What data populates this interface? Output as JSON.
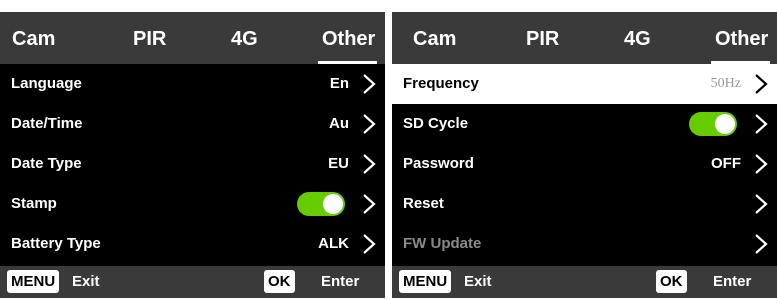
{
  "colors": {
    "header_bg": "#3a3a3a",
    "screen_bg": "#000000",
    "toggle_on": "#66cc00",
    "selected_row_bg": "#ffffff",
    "disabled_text": "#8a8a8a"
  },
  "left_screen": {
    "tabs": [
      {
        "label": "Cam"
      },
      {
        "label": "PIR"
      },
      {
        "label": "4G"
      },
      {
        "label": "Other",
        "active": true
      }
    ],
    "rows": [
      {
        "label": "Language",
        "value": "En"
      },
      {
        "label": "Date/Time",
        "value": "Au"
      },
      {
        "label": "Date Type",
        "value": "EU"
      },
      {
        "label": "Stamp",
        "toggle": "on"
      },
      {
        "label": "Battery Type",
        "value": "ALK"
      }
    ],
    "footer": {
      "menu_key": "MENU",
      "menu_action": "Exit",
      "ok_key": "OK",
      "ok_action": "Enter"
    }
  },
  "right_screen": {
    "tabs": [
      {
        "label": "Cam"
      },
      {
        "label": "PIR"
      },
      {
        "label": "4G"
      },
      {
        "label": "Other",
        "active": true
      }
    ],
    "rows": [
      {
        "label": "Frequency",
        "value": "50Hz",
        "selected": true
      },
      {
        "label": "SD Cycle",
        "toggle": "on"
      },
      {
        "label": "Password",
        "value": "OFF"
      },
      {
        "label": "Reset",
        "value": ""
      },
      {
        "label": "FW Update",
        "value": "",
        "disabled": true
      }
    ],
    "footer": {
      "menu_key": "MENU",
      "menu_action": "Exit",
      "ok_key": "OK",
      "ok_action": "Enter"
    }
  },
  "icons": {
    "row_arrow": "chevron-right-icon"
  }
}
